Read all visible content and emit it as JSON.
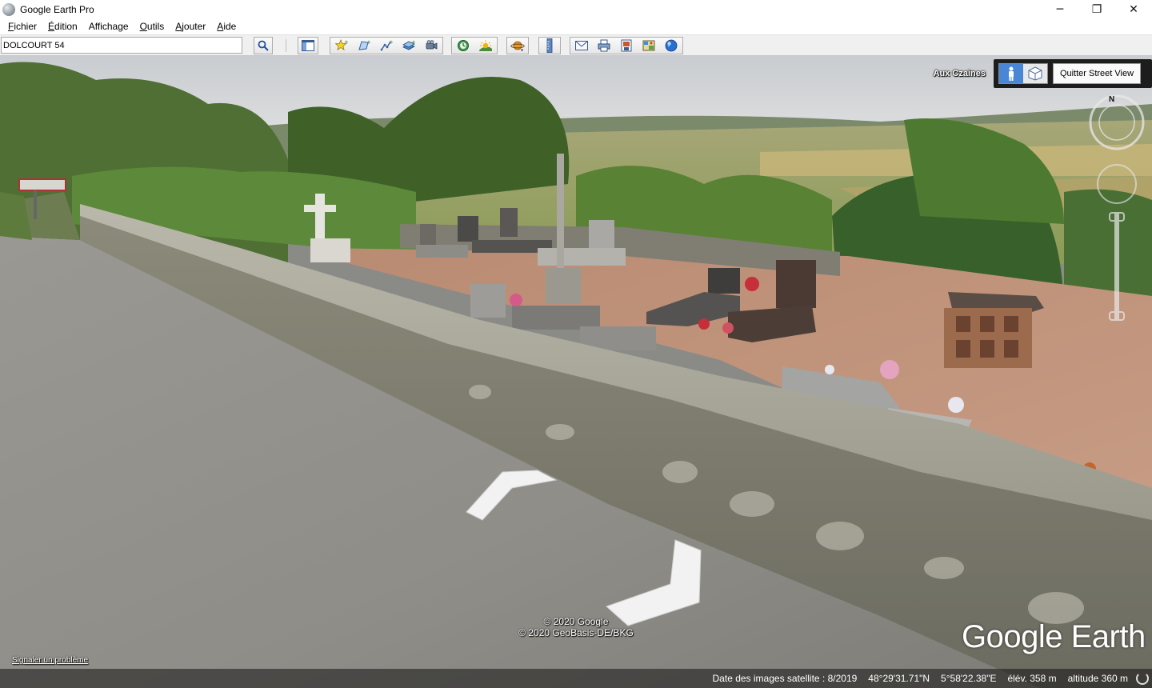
{
  "window": {
    "title": "Google Earth Pro",
    "minimize": "─",
    "maximize": "❐",
    "close": "✕"
  },
  "menu": {
    "items": [
      {
        "first": "F",
        "rest": "ichier"
      },
      {
        "first": "É",
        "rest": "dition"
      },
      {
        "first": "",
        "rest": "Affichage"
      },
      {
        "first": "O",
        "rest": "utils"
      },
      {
        "first": "A",
        "rest": "jouter"
      },
      {
        "first": "A",
        "rest": "ide"
      }
    ]
  },
  "toolbar": {
    "search_value": "DOLCOURT 54",
    "icons": [
      "search-icon",
      "sidebar-icon",
      "placemark-icon",
      "polygon-icon",
      "path-icon",
      "image-overlay-icon",
      "record-tour-icon",
      "historical-imagery-icon",
      "sunlight-icon",
      "planets-icon",
      "ruler-icon",
      "email-icon",
      "print-icon",
      "save-image-icon",
      "view-in-maps-icon",
      "earth-icon"
    ]
  },
  "streetview": {
    "place_label": "Aux Czaines",
    "quit_label": "Quitter Street View",
    "compass_north": "N",
    "copyright_line1": "© 2020 Google",
    "copyright_line2": "© 2020 GeoBasis-DE/BKG",
    "brand": "Google Earth",
    "report_link": "Signaler un problème"
  },
  "status": {
    "imagery_date": "Date des images satellite : 8/2019",
    "latitude": "48°29'31.71\"N",
    "longitude": "5°58'22.38\"E",
    "elevation": "élév.  358 m",
    "altitude": "altitude   360 m"
  }
}
